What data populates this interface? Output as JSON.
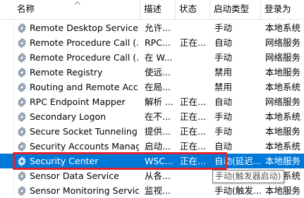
{
  "header": {
    "name": "名称",
    "description": "描述",
    "status": "状态",
    "startup_type": "启动类型",
    "logon_as": "登录为"
  },
  "rows": [
    {
      "name": "Remote Desktop Service...",
      "desc": "允许...",
      "status": "",
      "start": "手动",
      "logon": "本地系统"
    },
    {
      "name": "Remote Procedure Call (...",
      "desc": "RPC...",
      "status": "正在...",
      "start": "自动",
      "logon": "网络服务"
    },
    {
      "name": "Remote Procedure Call (...",
      "desc": "在 W...",
      "status": "",
      "start": "手动",
      "logon": "网络服务"
    },
    {
      "name": "Remote Registry",
      "desc": "使远...",
      "status": "",
      "start": "禁用",
      "logon": "本地服务"
    },
    {
      "name": "Routing and Remote Acc...",
      "desc": "在局...",
      "status": "",
      "start": "禁用",
      "logon": "本地系统"
    },
    {
      "name": "RPC Endpoint Mapper",
      "desc": "解析 ...",
      "status": "正在...",
      "start": "自动",
      "logon": "网络服务"
    },
    {
      "name": "Secondary Logon",
      "desc": "在不...",
      "status": "正在...",
      "start": "手动",
      "logon": "本地系统"
    },
    {
      "name": "Secure Socket Tunneling ...",
      "desc": "提供...",
      "status": "正在...",
      "start": "手动",
      "logon": "本地服务"
    },
    {
      "name": "Security Accounts Manag...",
      "desc": "启动...",
      "status": "正在...",
      "start": "自动",
      "logon": "本地系统"
    },
    {
      "name": "Security Center",
      "desc": "WSC...",
      "status": "正在...",
      "start": "自动(延迟...",
      "logon": "本地服务",
      "selected": true
    },
    {
      "name": "Sensor Data Service",
      "desc": "从各...",
      "status": "",
      "start": "手动(触发...",
      "logon": "本地系统"
    },
    {
      "name": "Sensor Monitoring Service",
      "desc": "监视...",
      "status": "",
      "start": "手动(触发...",
      "logon": "本地服务"
    }
  ],
  "tooltip": {
    "text": "手动(触发器启动)"
  },
  "colors": {
    "selection": "#0078d7",
    "highlight_border": "#e0202a"
  },
  "icons": {
    "row_icon": "service-gear-icon",
    "sort": "sort-ascending-icon"
  }
}
